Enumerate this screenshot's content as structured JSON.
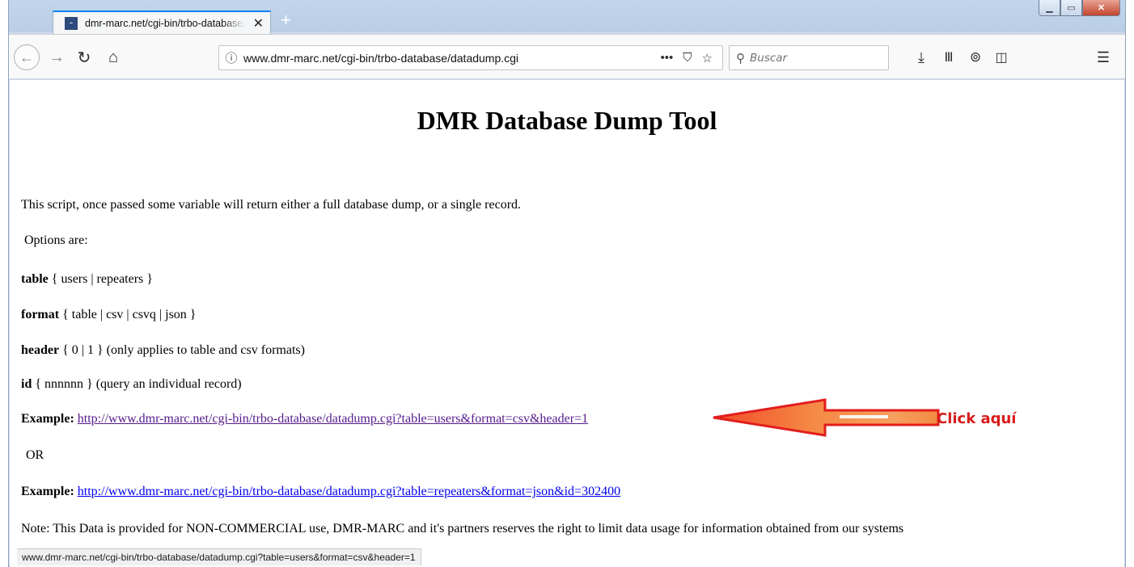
{
  "browser": {
    "tab_title": "dmr-marc.net/cgi-bin/trbo-database/datadump.cgi",
    "favicon_text": "DMR-MARC",
    "new_tab_label": "+",
    "url": "www.dmr-marc.net/cgi-bin/trbo-database/datadump.cgi",
    "search_placeholder": "Buscar",
    "status_url": "www.dmr-marc.net/cgi-bin/trbo-database/datadump.cgi?table=users&format=csv&header=1"
  },
  "icons": {
    "back": "back-arrow-icon",
    "forward": "forward-arrow-icon",
    "reload": "reload-icon",
    "home": "home-icon",
    "info": "info-icon",
    "page_actions": "more-icon",
    "pocket": "pocket-icon",
    "bookmark": "star-icon",
    "search": "search-icon",
    "downloads": "download-icon",
    "library": "library-icon",
    "sync": "sync-icon",
    "sidebar": "sidebar-icon",
    "menu": "hamburger-icon"
  },
  "page": {
    "title": "DMR Database Dump Tool",
    "intro": "This script, once passed some variable will return either a full database dump, or a single record.",
    "options_label": "Options are:",
    "options": [
      {
        "key": "table",
        "value": "{ users | repeaters }"
      },
      {
        "key": "format",
        "value": "{ table | csv | csvq | json }"
      },
      {
        "key": "header",
        "value": "{ 0 | 1 } (only applies to table and csv formats)"
      },
      {
        "key": "id",
        "value": "{ nnnnnn } (query an individual record)"
      }
    ],
    "example_label": "Example:",
    "example1_url": "http://www.dmr-marc.net/cgi-bin/trbo-database/datadump.cgi?table=users&format=csv&header=1",
    "or_text": "OR",
    "example2_url": "http://www.dmr-marc.net/cgi-bin/trbo-database/datadump.cgi?table=repeaters&format=json&id=302400",
    "note": "Note: This Data is provided for NON-COMMERCIAL use, DMR-MARC and it's partners reserves the right to limit data usage for information obtained from our systems"
  },
  "annotation": {
    "label": "Click aquí",
    "color": "#d81b1b"
  }
}
